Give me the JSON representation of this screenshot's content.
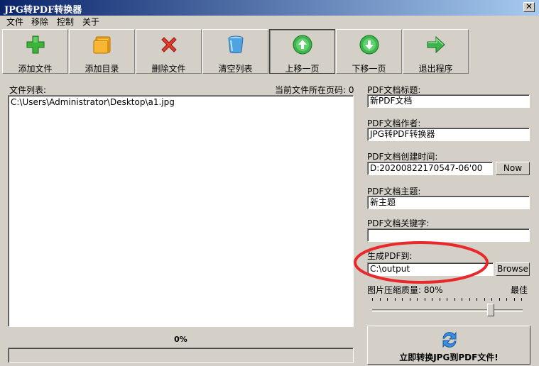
{
  "window": {
    "title": "JPG转PDF转换器",
    "close_glyph": "✕"
  },
  "menu": [
    "文件",
    "移除",
    "控制",
    "关于"
  ],
  "toolbar": [
    {
      "label": "添加文件",
      "icon": "plus-icon"
    },
    {
      "label": "添加目录",
      "icon": "folder-icon"
    },
    {
      "label": "删除文件",
      "icon": "delete-x-icon"
    },
    {
      "label": "清空列表",
      "icon": "trash-can-icon"
    },
    {
      "label": "上移一页",
      "icon": "arrow-up-circle-icon"
    },
    {
      "label": "下移一页",
      "icon": "arrow-down-circle-icon"
    },
    {
      "label": "退出程序",
      "icon": "exit-arrow-icon"
    }
  ],
  "file_list": {
    "label": "文件列表:",
    "page_info": "当前文件所在页码: 0",
    "items": [
      "C:\\Users\\Administrator\\Desktop\\a1.jpg"
    ]
  },
  "progress": {
    "text": "0%",
    "value": 0
  },
  "pdf": {
    "title_label": "PDF文档标题:",
    "title_value": "新PDF文档",
    "author_label": "PDF文档作者:",
    "author_value": "JPG转PDF转换器",
    "created_label": "PDF文档创建时间:",
    "created_value": "D:20200822170547-06'00",
    "now_button": "Now",
    "subject_label": "PDF文档主题:",
    "subject_value": "新主题",
    "keywords_label": "PDF文档关键字:",
    "keywords_value": "",
    "output_label": "生成PDF到:",
    "output_value": "C:\\output",
    "browse_button": "Browse",
    "quality_label": "图片压缩质量: 80%",
    "quality_best": "最佳",
    "quality_value": 80,
    "convert_button": "立即转换JPG到PDF文件!"
  },
  "colors": {
    "highlight_circle": "#e8282a",
    "title_bar_start": "#0a246a",
    "title_bar_end": "#a6caf0"
  }
}
